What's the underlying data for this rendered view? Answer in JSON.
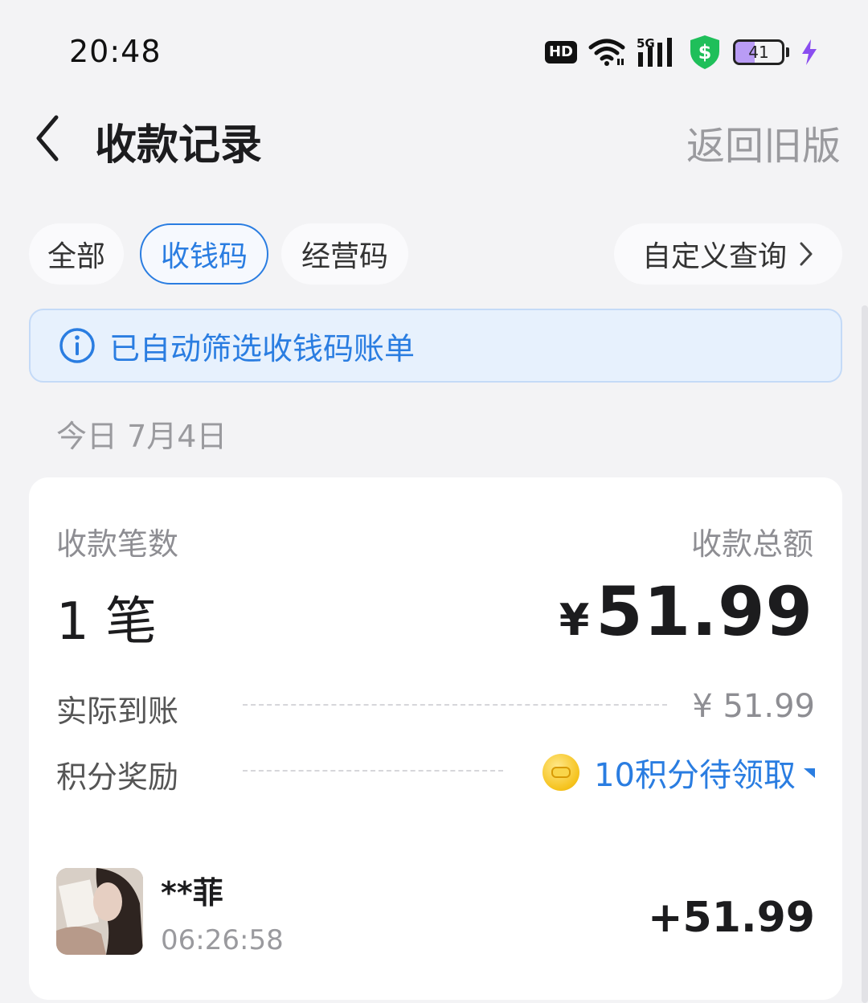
{
  "status_bar": {
    "time": "20:48",
    "hd_badge": "HD",
    "network": "5G",
    "battery_level": "41",
    "battery_fraction": 0.41,
    "icons": [
      "hd-icon",
      "wifi-icon",
      "signal-5g-icon",
      "shield-dollar-icon",
      "battery-icon",
      "charging-bolt-icon"
    ]
  },
  "header": {
    "title": "收款记录",
    "right_link": "返回旧版",
    "back_icon": "chevron-left-icon"
  },
  "tabs": {
    "items": [
      {
        "label": "全部",
        "active": false
      },
      {
        "label": "收钱码",
        "active": true
      },
      {
        "label": "经营码",
        "active": false
      }
    ],
    "custom_query": "自定义查询"
  },
  "notice": {
    "text": "已自动筛选收钱码账单",
    "icon": "info-icon"
  },
  "date_label": "今日 7月4日",
  "summary": {
    "count_label": "收款笔数",
    "count_value": "1 笔",
    "total_label": "收款总额",
    "total_currency": "¥",
    "total_value": "51.99",
    "actual_label": "实际到账",
    "actual_value": "¥ 51.99",
    "reward_label": "积分奖励",
    "reward_value": "10积分待领取"
  },
  "transaction": {
    "name": "**菲",
    "time": "06:26:58",
    "amount": "+51.99"
  },
  "colors": {
    "accent": "#2a7de1",
    "background": "#f3f3f5",
    "card": "#ffffff",
    "muted": "#9a9a9e",
    "shield_green": "#1fbf5a",
    "battery_fill": "#b99cf5",
    "bolt_purple": "#8a4df0"
  }
}
